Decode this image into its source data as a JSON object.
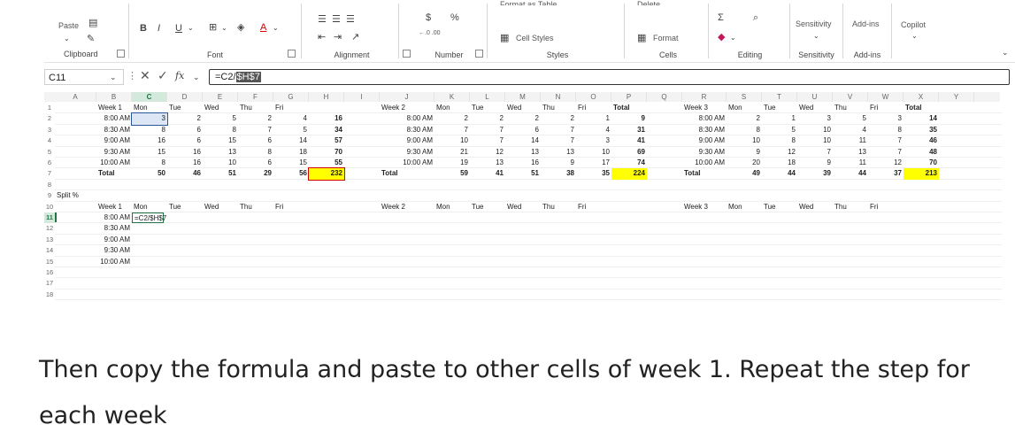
{
  "ribbon": {
    "paste": "Paste",
    "bold": "B",
    "italic": "I",
    "underline": "U",
    "font_color_glyph": "A",
    "clipboard": "Clipboard",
    "font": "Font",
    "alignment": "Alignment",
    "number": "Number",
    "styles": "Styles",
    "cells": "Cells",
    "editing": "Editing",
    "sensitivity_group": "Sensitivity",
    "addins_group": "Add-ins",
    "sensitivity_btn": "Sensitivity",
    "addins_btn": "Add-ins",
    "copilot": "Copilot",
    "format_as_table": "Format as Table",
    "cell_styles": "Cell Styles",
    "delete": "Delete",
    "format": "Format",
    "dec_inc": "←.0 .00",
    "dec_dec": ".00 →.0"
  },
  "formula_bar": {
    "name_box": "C11",
    "fx": "fx",
    "formula_prefix": "=C2/",
    "formula_ref": "$H$7"
  },
  "col_letters": [
    "A",
    "B",
    "C",
    "D",
    "E",
    "F",
    "G",
    "H",
    "I",
    "J",
    "K",
    "L",
    "M",
    "N",
    "O",
    "P",
    "Q",
    "R",
    "S",
    "T",
    "U",
    "V",
    "W",
    "X",
    "Y"
  ],
  "row_numbers": [
    "1",
    "2",
    "3",
    "4",
    "5",
    "6",
    "7",
    "8",
    "9",
    "10",
    "11",
    "12",
    "13",
    "14",
    "15",
    "16",
    "17",
    "18"
  ],
  "week_headers": [
    {
      "week": "Week 1",
      "days": [
        "Mon",
        "Tue",
        "Wed",
        "Thu",
        "Fri"
      ]
    },
    {
      "week": "Week 2",
      "days": [
        "Mon",
        "Tue",
        "Wed",
        "Thu",
        "Fri"
      ],
      "total": "Total"
    },
    {
      "week": "Week 3",
      "days": [
        "Mon",
        "Tue",
        "Wed",
        "Thu",
        "Fri"
      ],
      "total": "Total"
    }
  ],
  "times": [
    "8:00 AM",
    "8:30 AM",
    "9:00 AM",
    "9:30 AM",
    "10:00 AM"
  ],
  "total_label": "Total",
  "week1": {
    "rows": [
      [
        3,
        2,
        5,
        2,
        4,
        16
      ],
      [
        8,
        6,
        8,
        7,
        5,
        34
      ],
      [
        16,
        6,
        15,
        6,
        14,
        57
      ],
      [
        15,
        16,
        13,
        8,
        18,
        70
      ],
      [
        8,
        16,
        10,
        6,
        15,
        55
      ]
    ],
    "totals": [
      50,
      46,
      51,
      29,
      56,
      232
    ]
  },
  "week2": {
    "rows": [
      [
        2,
        2,
        2,
        2,
        1,
        9
      ],
      [
        7,
        7,
        6,
        7,
        4,
        31
      ],
      [
        10,
        7,
        14,
        7,
        3,
        41
      ],
      [
        21,
        12,
        13,
        13,
        10,
        69
      ],
      [
        19,
        13,
        16,
        9,
        17,
        74
      ]
    ],
    "totals": [
      59,
      41,
      51,
      38,
      35,
      224
    ]
  },
  "week3": {
    "rows": [
      [
        2,
        1,
        3,
        5,
        3,
        14
      ],
      [
        8,
        5,
        10,
        4,
        8,
        35
      ],
      [
        10,
        8,
        10,
        11,
        7,
        46
      ],
      [
        9,
        12,
        7,
        13,
        7,
        48
      ],
      [
        20,
        18,
        9,
        11,
        12,
        70
      ]
    ],
    "totals": [
      49,
      44,
      39,
      44,
      37,
      213
    ]
  },
  "split_label": "Split %",
  "split_formula": "=C2/$H$7",
  "caption": "Then copy the formula and paste to other cells of week 1. Repeat the step for each week",
  "colors": {
    "highlight": "#ffff00",
    "selection": "#217346",
    "accent_blue": "#2b579a"
  }
}
